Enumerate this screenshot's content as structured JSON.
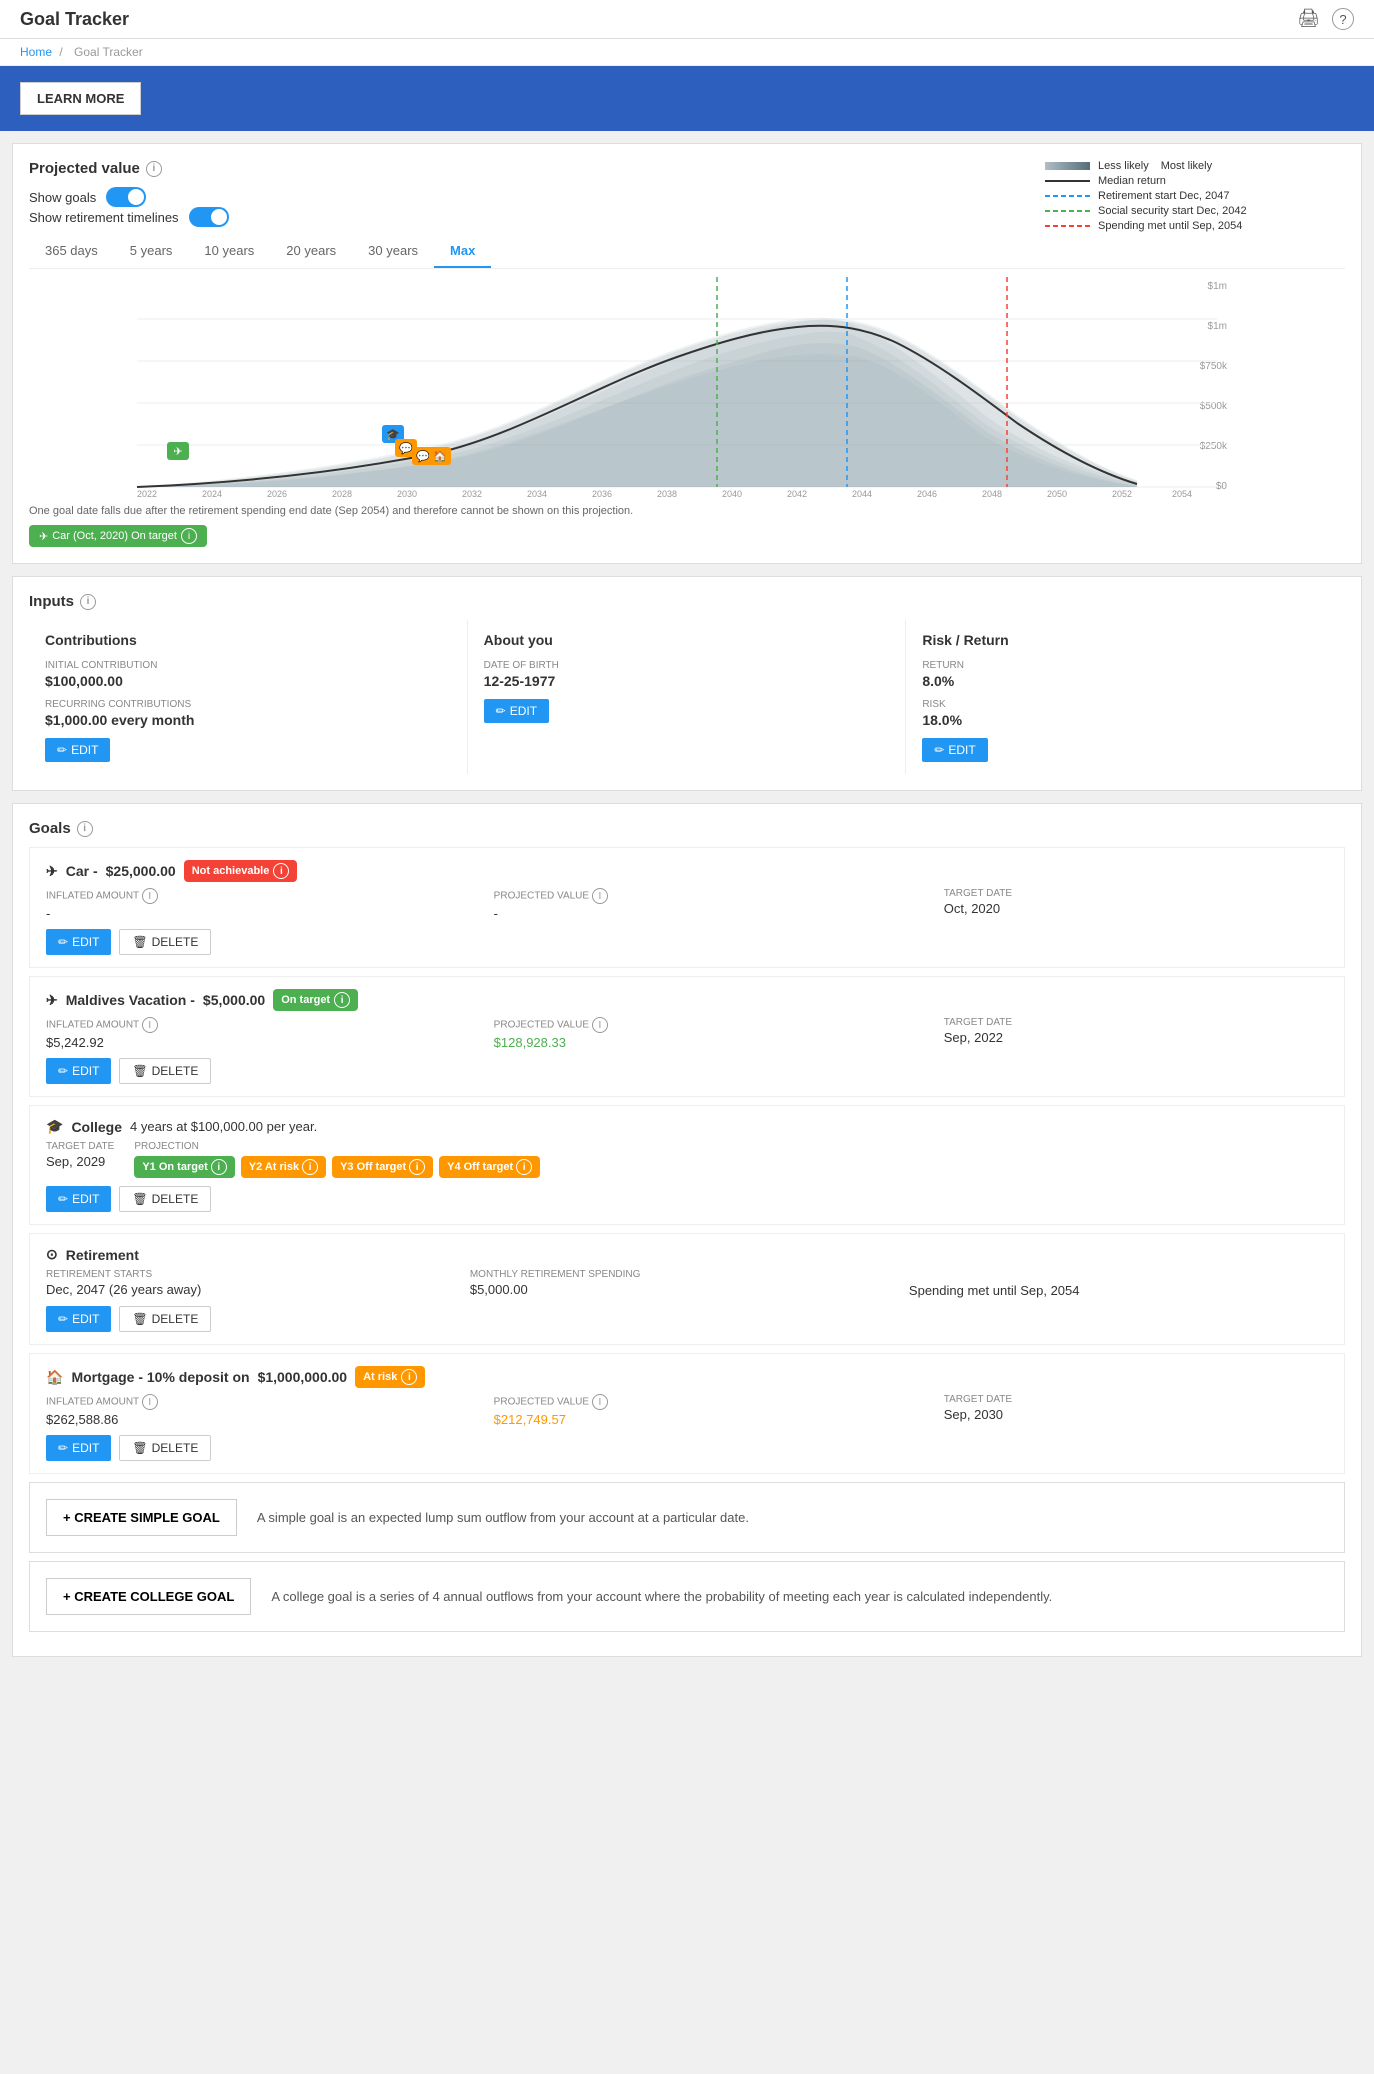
{
  "header": {
    "title": "Goal Tracker",
    "print_icon": "🖨",
    "help_icon": "?"
  },
  "breadcrumb": {
    "home": "Home",
    "separator": "/",
    "current": "Goal Tracker"
  },
  "banner": {
    "button_label": "LEARN MORE"
  },
  "projected": {
    "title": "Projected value",
    "show_goals_label": "Show goals",
    "show_retirement_label": "Show retirement timelines",
    "legend": {
      "less_likely": "Less likely",
      "most_likely": "Most likely",
      "median_return": "Median return",
      "retirement_start": "Retirement start Dec, 2047",
      "social_security": "Social security start Dec, 2042",
      "spending_met": "Spending met until Sep, 2054"
    },
    "time_tabs": [
      "365 days",
      "5 years",
      "10 years",
      "20 years",
      "30 years",
      "Max"
    ],
    "active_tab": "Max",
    "chart_note": "One goal date falls due after the retirement spending end date (Sep 2054) and therefore cannot be shown on this projection.",
    "goal_badge": "Car (Oct, 2020) On target",
    "y_axis": [
      "$1m",
      "$1m",
      "$750k",
      "$500k",
      "$250k",
      "$0"
    ],
    "x_axis": [
      "2022",
      "2024",
      "2026",
      "2028",
      "2030",
      "2032",
      "2034",
      "2036",
      "2038",
      "2040",
      "2042",
      "2044",
      "2046",
      "2048",
      "2050",
      "2052",
      "2054"
    ]
  },
  "inputs": {
    "title": "Inputs",
    "contributions": {
      "title": "Contributions",
      "initial_label": "INITIAL CONTRIBUTION",
      "initial_value": "$100,000.00",
      "recurring_label": "RECURRING CONTRIBUTIONS",
      "recurring_value": "$1,000.00 every month",
      "edit_label": "EDIT"
    },
    "about_you": {
      "title": "About you",
      "dob_label": "DATE OF BIRTH",
      "dob_value": "12-25-1977",
      "edit_label": "EDIT"
    },
    "risk_return": {
      "title": "Risk / Return",
      "return_label": "RETURN",
      "return_value": "8.0%",
      "risk_label": "RISK",
      "risk_value": "18.0%",
      "edit_label": "EDIT"
    }
  },
  "goals": {
    "title": "Goals",
    "items": [
      {
        "id": "car",
        "icon": "✈",
        "name": "Car",
        "amount": "$25,000.00",
        "status": "Not achievable",
        "status_type": "red",
        "inflated_label": "INFLATED AMOUNT",
        "inflated_value": "-",
        "projected_label": "PROJECTED VALUE",
        "projected_value": "-",
        "target_label": "TARGET DATE",
        "target_value": "Oct, 2020",
        "edit_label": "EDIT",
        "delete_label": "DELETE"
      },
      {
        "id": "maldives",
        "icon": "✈",
        "name": "Maldives Vacation",
        "amount": "$5,000.00",
        "status": "On target",
        "status_type": "green",
        "inflated_label": "INFLATED AMOUNT",
        "inflated_value": "$5,242.92",
        "projected_label": "PROJECTED VALUE",
        "projected_value": "$128,928.33",
        "projected_value_color": "green",
        "target_label": "TARGET DATE",
        "target_value": "Sep, 2022",
        "edit_label": "EDIT",
        "delete_label": "DELETE"
      },
      {
        "id": "college",
        "icon": "🎓",
        "name": "College",
        "subtitle": "4 years at $100,000.00 per year.",
        "target_label": "TARGET DATE",
        "target_value": "Sep, 2029",
        "projection_label": "PROJECTION",
        "year_badges": [
          {
            "label": "Y1 On target",
            "type": "green"
          },
          {
            "label": "Y2 At risk",
            "type": "orange"
          },
          {
            "label": "Y3 Off target",
            "type": "orange"
          },
          {
            "label": "Y4 Off target",
            "type": "orange"
          }
        ],
        "edit_label": "EDIT",
        "delete_label": "DELETE"
      },
      {
        "id": "retirement",
        "icon": "⊙",
        "name": "Retirement",
        "retirement_starts_label": "RETIREMENT STARTS",
        "retirement_starts_value": "Dec, 2047 (26 years away)",
        "monthly_spending_label": "MONTHLY RETIREMENT SPENDING",
        "monthly_spending_value": "$5,000.00",
        "spending_met": "Spending met until Sep, 2054",
        "edit_label": "EDIT",
        "delete_label": "DELETE"
      },
      {
        "id": "mortgage",
        "icon": "🏠",
        "name": "Mortgage - 10% deposit on",
        "amount": "$1,000,000.00",
        "status": "At risk",
        "status_type": "orange",
        "inflated_label": "INFLATED AMOUNT",
        "inflated_value": "$262,588.86",
        "projected_label": "PROJECTED VALUE",
        "projected_value": "$212,749.57",
        "projected_value_color": "orange",
        "target_label": "TARGET DATE",
        "target_value": "Sep, 2030",
        "edit_label": "EDIT",
        "delete_label": "DELETE"
      }
    ],
    "create_simple": {
      "button_label": "+ CREATE SIMPLE GOAL",
      "description": "A simple goal is an expected lump sum outflow from your account at a particular date."
    },
    "create_college": {
      "button_label": "+ CREATE COLLEGE GOAL",
      "description": "A college goal is a series of 4 annual outflows from your account where the probability of meeting each year is calculated independently."
    }
  }
}
